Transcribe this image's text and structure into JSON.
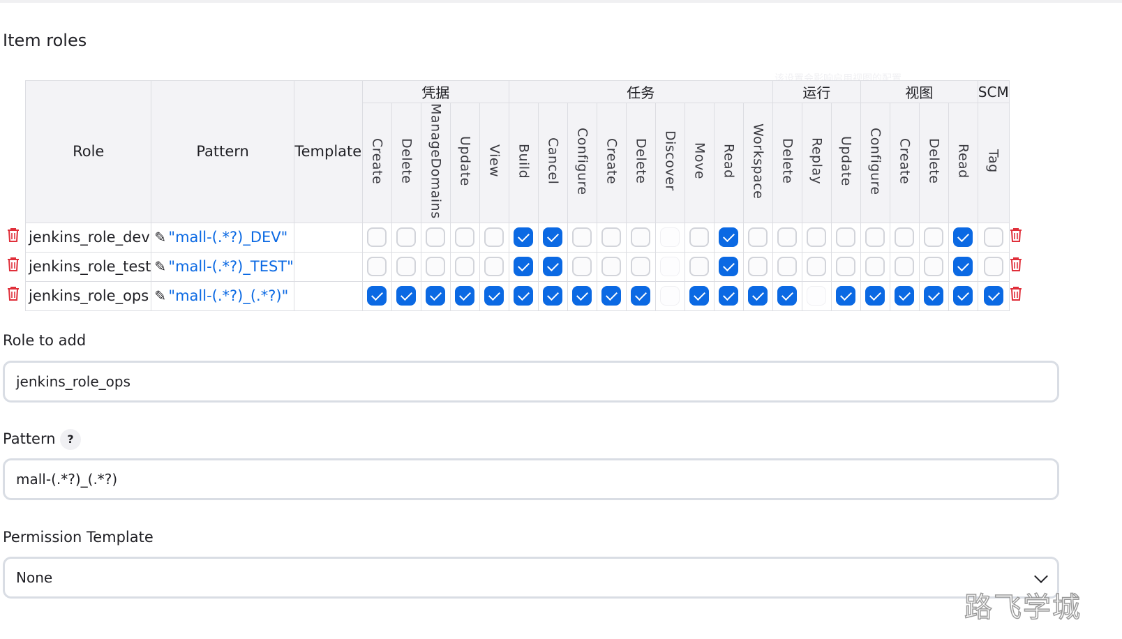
{
  "section_title": "Item roles",
  "faint_hint": "该设置会影响启用视图的配置",
  "table": {
    "headers": {
      "role": "Role",
      "pattern": "Pattern",
      "template": "Template"
    },
    "groups": [
      {
        "label": "凭据",
        "span": 5
      },
      {
        "label": "任务",
        "span": 9
      },
      {
        "label": "运行",
        "span": 3
      },
      {
        "label": "视图",
        "span": 4
      },
      {
        "label": "SCM",
        "span": 1
      }
    ],
    "permissions": [
      "Create",
      "Delete",
      "ManageDomains",
      "Update",
      "View",
      "Build",
      "Cancel",
      "Configure",
      "Create",
      "Delete",
      "Discover",
      "Move",
      "Read",
      "Workspace",
      "Delete",
      "Replay",
      "Update",
      "Configure",
      "Create",
      "Delete",
      "Read",
      "Tag"
    ],
    "rows": [
      {
        "role": "jenkins_role_dev",
        "pattern": "\"mall-(.*?)_DEV\"",
        "checks": [
          "off",
          "off",
          "off",
          "off",
          "off",
          "on",
          "on",
          "off",
          "off",
          "off",
          "dis",
          "off",
          "on",
          "off",
          "off",
          "off",
          "off",
          "off",
          "off",
          "off",
          "on",
          "off"
        ]
      },
      {
        "role": "jenkins_role_test",
        "pattern": "\"mall-(.*?)_TEST\"",
        "checks": [
          "off",
          "off",
          "off",
          "off",
          "off",
          "on",
          "on",
          "off",
          "off",
          "off",
          "dis",
          "off",
          "on",
          "off",
          "off",
          "off",
          "off",
          "off",
          "off",
          "off",
          "on",
          "off"
        ]
      },
      {
        "role": "jenkins_role_ops",
        "pattern": "\"mall-(.*?)_(.*?)\"",
        "checks": [
          "on",
          "on",
          "on",
          "on",
          "on",
          "on",
          "on",
          "on",
          "on",
          "on",
          "dis",
          "on",
          "on",
          "on",
          "on",
          "dis",
          "on",
          "on",
          "on",
          "on",
          "on",
          "on"
        ]
      }
    ]
  },
  "role_to_add": {
    "label": "Role to add",
    "value": "jenkins_role_ops"
  },
  "pattern_field": {
    "label": "Pattern",
    "help": "?",
    "value": "mall-(.*?)_(.*?)"
  },
  "permission_template": {
    "label": "Permission Template",
    "selected": "None"
  },
  "watermark": "路飞学城",
  "colors": {
    "accent": "#0b69e3",
    "danger": "#e02f3a"
  }
}
